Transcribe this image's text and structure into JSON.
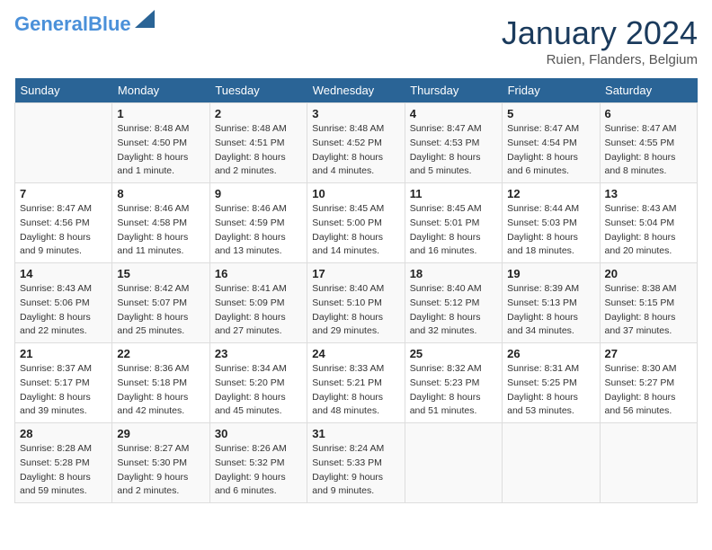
{
  "header": {
    "logo_general": "General",
    "logo_blue": "Blue",
    "month_title": "January 2024",
    "location": "Ruien, Flanders, Belgium"
  },
  "days_of_week": [
    "Sunday",
    "Monday",
    "Tuesday",
    "Wednesday",
    "Thursday",
    "Friday",
    "Saturday"
  ],
  "weeks": [
    [
      {
        "day": "",
        "info": ""
      },
      {
        "day": "1",
        "info": "Sunrise: 8:48 AM\nSunset: 4:50 PM\nDaylight: 8 hours\nand 1 minute."
      },
      {
        "day": "2",
        "info": "Sunrise: 8:48 AM\nSunset: 4:51 PM\nDaylight: 8 hours\nand 2 minutes."
      },
      {
        "day": "3",
        "info": "Sunrise: 8:48 AM\nSunset: 4:52 PM\nDaylight: 8 hours\nand 4 minutes."
      },
      {
        "day": "4",
        "info": "Sunrise: 8:47 AM\nSunset: 4:53 PM\nDaylight: 8 hours\nand 5 minutes."
      },
      {
        "day": "5",
        "info": "Sunrise: 8:47 AM\nSunset: 4:54 PM\nDaylight: 8 hours\nand 6 minutes."
      },
      {
        "day": "6",
        "info": "Sunrise: 8:47 AM\nSunset: 4:55 PM\nDaylight: 8 hours\nand 8 minutes."
      }
    ],
    [
      {
        "day": "7",
        "info": "Sunrise: 8:47 AM\nSunset: 4:56 PM\nDaylight: 8 hours\nand 9 minutes."
      },
      {
        "day": "8",
        "info": "Sunrise: 8:46 AM\nSunset: 4:58 PM\nDaylight: 8 hours\nand 11 minutes."
      },
      {
        "day": "9",
        "info": "Sunrise: 8:46 AM\nSunset: 4:59 PM\nDaylight: 8 hours\nand 13 minutes."
      },
      {
        "day": "10",
        "info": "Sunrise: 8:45 AM\nSunset: 5:00 PM\nDaylight: 8 hours\nand 14 minutes."
      },
      {
        "day": "11",
        "info": "Sunrise: 8:45 AM\nSunset: 5:01 PM\nDaylight: 8 hours\nand 16 minutes."
      },
      {
        "day": "12",
        "info": "Sunrise: 8:44 AM\nSunset: 5:03 PM\nDaylight: 8 hours\nand 18 minutes."
      },
      {
        "day": "13",
        "info": "Sunrise: 8:43 AM\nSunset: 5:04 PM\nDaylight: 8 hours\nand 20 minutes."
      }
    ],
    [
      {
        "day": "14",
        "info": "Sunrise: 8:43 AM\nSunset: 5:06 PM\nDaylight: 8 hours\nand 22 minutes."
      },
      {
        "day": "15",
        "info": "Sunrise: 8:42 AM\nSunset: 5:07 PM\nDaylight: 8 hours\nand 25 minutes."
      },
      {
        "day": "16",
        "info": "Sunrise: 8:41 AM\nSunset: 5:09 PM\nDaylight: 8 hours\nand 27 minutes."
      },
      {
        "day": "17",
        "info": "Sunrise: 8:40 AM\nSunset: 5:10 PM\nDaylight: 8 hours\nand 29 minutes."
      },
      {
        "day": "18",
        "info": "Sunrise: 8:40 AM\nSunset: 5:12 PM\nDaylight: 8 hours\nand 32 minutes."
      },
      {
        "day": "19",
        "info": "Sunrise: 8:39 AM\nSunset: 5:13 PM\nDaylight: 8 hours\nand 34 minutes."
      },
      {
        "day": "20",
        "info": "Sunrise: 8:38 AM\nSunset: 5:15 PM\nDaylight: 8 hours\nand 37 minutes."
      }
    ],
    [
      {
        "day": "21",
        "info": "Sunrise: 8:37 AM\nSunset: 5:17 PM\nDaylight: 8 hours\nand 39 minutes."
      },
      {
        "day": "22",
        "info": "Sunrise: 8:36 AM\nSunset: 5:18 PM\nDaylight: 8 hours\nand 42 minutes."
      },
      {
        "day": "23",
        "info": "Sunrise: 8:34 AM\nSunset: 5:20 PM\nDaylight: 8 hours\nand 45 minutes."
      },
      {
        "day": "24",
        "info": "Sunrise: 8:33 AM\nSunset: 5:21 PM\nDaylight: 8 hours\nand 48 minutes."
      },
      {
        "day": "25",
        "info": "Sunrise: 8:32 AM\nSunset: 5:23 PM\nDaylight: 8 hours\nand 51 minutes."
      },
      {
        "day": "26",
        "info": "Sunrise: 8:31 AM\nSunset: 5:25 PM\nDaylight: 8 hours\nand 53 minutes."
      },
      {
        "day": "27",
        "info": "Sunrise: 8:30 AM\nSunset: 5:27 PM\nDaylight: 8 hours\nand 56 minutes."
      }
    ],
    [
      {
        "day": "28",
        "info": "Sunrise: 8:28 AM\nSunset: 5:28 PM\nDaylight: 8 hours\nand 59 minutes."
      },
      {
        "day": "29",
        "info": "Sunrise: 8:27 AM\nSunset: 5:30 PM\nDaylight: 9 hours\nand 2 minutes."
      },
      {
        "day": "30",
        "info": "Sunrise: 8:26 AM\nSunset: 5:32 PM\nDaylight: 9 hours\nand 6 minutes."
      },
      {
        "day": "31",
        "info": "Sunrise: 8:24 AM\nSunset: 5:33 PM\nDaylight: 9 hours\nand 9 minutes."
      },
      {
        "day": "",
        "info": ""
      },
      {
        "day": "",
        "info": ""
      },
      {
        "day": "",
        "info": ""
      }
    ]
  ]
}
